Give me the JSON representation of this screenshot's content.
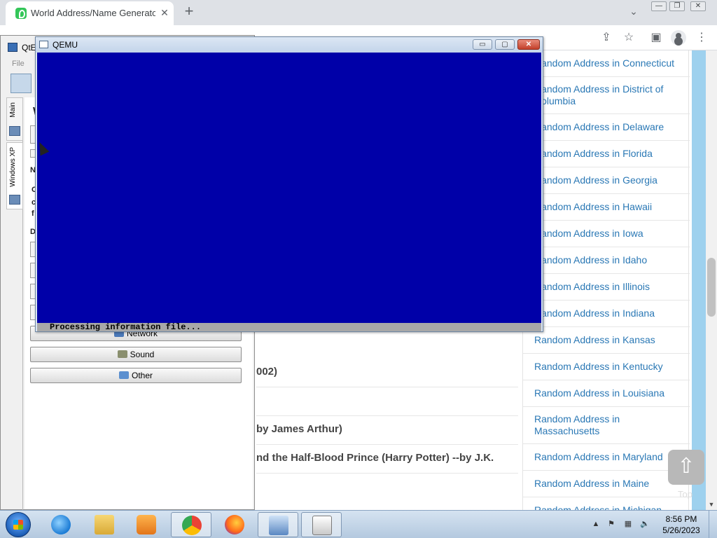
{
  "browser": {
    "tab_title": "World Address/Name Generator",
    "tab_close": "✕",
    "new_tab": "+",
    "tab_search": "⌄",
    "win_minimize": "—",
    "win_restore": "❐",
    "win_close": "✕"
  },
  "toolbar": {
    "share": "⇪",
    "star": "☆",
    "sidebar": "▣",
    "menu": "⋮"
  },
  "main_content": {
    "rows": [
      "002)",
      "by James Arthur)",
      "nd the Half-Blood Prince (Harry Potter) --by J.K."
    ]
  },
  "sidebar_links": [
    "Random Address in Connecticut",
    "Random Address in District of Columbia",
    "Random Address in Delaware",
    "Random Address in Florida",
    "Random Address in Georgia",
    "Random Address in Hawaii",
    "Random Address in Iowa",
    "Random Address in Idaho",
    "Random Address in Illinois",
    "Random Address in Indiana",
    "Random Address in Kansas",
    "Random Address in Kentucky",
    "Random Address in Louisiana",
    "Random Address in Massachusetts",
    "Random Address in Maryland",
    "Random Address in Maine",
    "Random Address in Michigan"
  ],
  "back_to_top": {
    "arrow": "⇧",
    "label": "Top"
  },
  "qtemu": {
    "title": "QtE",
    "menu_file": "File",
    "vtab_main": "Main",
    "vtab_winxp": "Windows XP",
    "buttons": {
      "network": "Network",
      "sound": "Sound",
      "other": "Other"
    },
    "stubs": {
      "w": "W",
      "n": "N",
      "c1": "C",
      "c2": "c",
      "f": "f",
      "d": "D"
    }
  },
  "qemu": {
    "title": "QEMU",
    "status_text": "Processing information file...",
    "screen_color": "#0000a8",
    "minimize": "▭",
    "restore": "▢",
    "close": "✕"
  },
  "taskbar": {
    "time": "8:56 PM",
    "date": "5/26/2023",
    "tray_arrow": "▲",
    "tray_flag": "⚑",
    "tray_network": "▦",
    "tray_volume": "🔈"
  }
}
